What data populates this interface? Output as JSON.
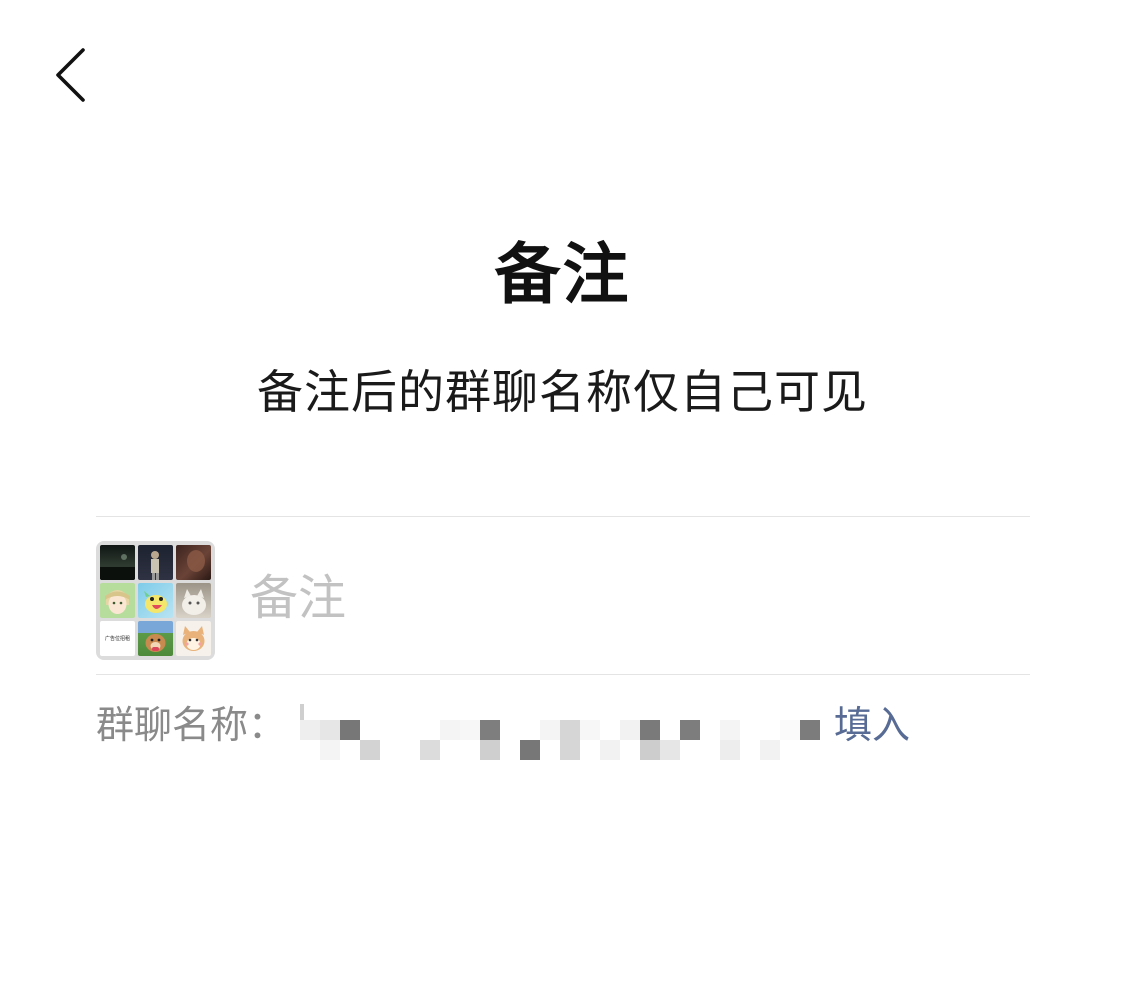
{
  "nav": {
    "back_icon": "chevron-left-icon"
  },
  "header": {
    "title": "备注",
    "subtitle": "备注后的群聊名称仅自己可见"
  },
  "remark": {
    "placeholder": "备注",
    "value": ""
  },
  "group_avatar": {
    "tiles": [
      {
        "name": "avatar-tile-dark-landscape",
        "color": "#1f2a24"
      },
      {
        "name": "avatar-tile-person-night",
        "color": "#2b2d36"
      },
      {
        "name": "avatar-tile-brown-portrait",
        "color": "#4b3029"
      },
      {
        "name": "avatar-tile-anime-boy",
        "color": "#a8d58f"
      },
      {
        "name": "avatar-tile-cartoon-bird",
        "color": "#74c6e6"
      },
      {
        "name": "avatar-tile-white-cat",
        "color": "#c7c0b4"
      },
      {
        "name": "avatar-tile-text-card",
        "color": "#ffffff",
        "text": "广告位招租"
      },
      {
        "name": "avatar-tile-dog-grass",
        "color": "#5f9a4c"
      },
      {
        "name": "avatar-tile-cartoon-shiba",
        "color": "#f4efe9"
      }
    ]
  },
  "group_name": {
    "label": "群聊名称：",
    "fill_label": "填入"
  },
  "colors": {
    "link": "#576b95",
    "placeholder": "#c2c2c2",
    "label": "#8a8a8a",
    "divider": "#e4e4e4"
  }
}
